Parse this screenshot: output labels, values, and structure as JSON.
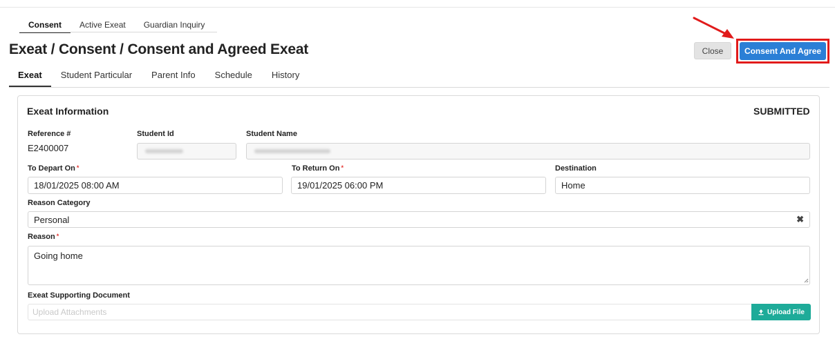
{
  "top_tabs": [
    {
      "label": "Consent",
      "active": true
    },
    {
      "label": "Active Exeat",
      "active": false
    },
    {
      "label": "Guardian Inquiry",
      "active": false
    }
  ],
  "page_title": "Exeat / Consent / Consent and Agreed Exeat",
  "header_buttons": {
    "close_label": "Close",
    "consent_label": "Consent And Agree"
  },
  "sub_tabs": [
    {
      "label": "Exeat",
      "active": true
    },
    {
      "label": "Student Particular",
      "active": false
    },
    {
      "label": "Parent Info",
      "active": false
    },
    {
      "label": "Schedule",
      "active": false
    },
    {
      "label": "History",
      "active": false
    }
  ],
  "exeat_info": {
    "title": "Exeat Information",
    "status": "SUBMITTED",
    "reference_label": "Reference #",
    "reference_value": "E2400007",
    "student_id_label": "Student Id",
    "student_name_label": "Student Name",
    "depart_label": "To Depart On",
    "depart_value": "18/01/2025 08:00 AM",
    "return_label": "To Return On",
    "return_value": "19/01/2025 06:00 PM",
    "destination_label": "Destination",
    "destination_value": "Home",
    "reason_category_label": "Reason Category",
    "reason_category_value": "Personal",
    "reason_label": "Reason",
    "reason_value": "Going home",
    "required_marker": "*",
    "doc_label": "Exeat Supporting Document",
    "upload_placeholder": "Upload Attachments",
    "upload_button_label": "Upload File"
  },
  "colors": {
    "primary": "#2b7fd6",
    "upload": "#1eab99",
    "highlight": "#e11b1b",
    "required": "#e53935"
  },
  "icons": {
    "upload": "upload-icon",
    "clear": "clear-x-icon",
    "arrow": "red-arrow-annotation"
  }
}
